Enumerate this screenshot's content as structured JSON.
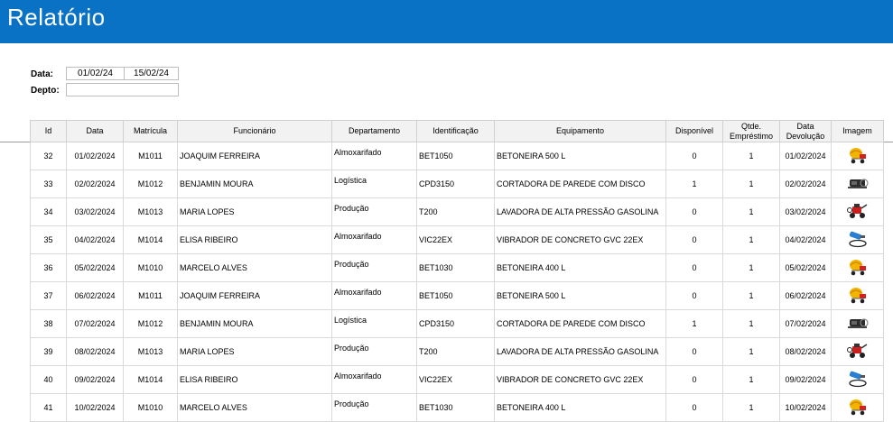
{
  "title": "Relatório",
  "filters": {
    "date_label": "Data:",
    "date_from": "01/02/24",
    "date_to": "15/02/24",
    "depto_label": "Depto:",
    "depto_value": ""
  },
  "table": {
    "headers": {
      "id": "Id",
      "data": "Data",
      "matricula": "Matrícula",
      "funcionario": "Funcionário",
      "departamento": "Departamento",
      "identificacao": "Identificação",
      "equipamento": "Equipamento",
      "disponivel": "Disponível",
      "qtde_line1": "Qtde.",
      "qtde_line2": "Empréstimo",
      "devol_line1": "Data",
      "devol_line2": "Devolução",
      "imagem": "Imagem"
    },
    "rows": [
      {
        "id": "32",
        "data": "01/02/2024",
        "matricula": "M1011",
        "funcionario": "JOAQUIM FERREIRA",
        "departamento": "Almoxarifado",
        "identificacao": "BET1050",
        "equipamento": "BETONEIRA 500 L",
        "disponivel": "0",
        "qtde": "1",
        "devolucao": "01/02/2024",
        "icon": "concrete-mixer-icon"
      },
      {
        "id": "33",
        "data": "02/02/2024",
        "matricula": "M1012",
        "funcionario": "BENJAMIN MOURA",
        "departamento": "Logística",
        "identificacao": "CPD3150",
        "equipamento": "CORTADORA DE PAREDE COM DISCO",
        "disponivel": "1",
        "qtde": "1",
        "devolucao": "02/02/2024",
        "icon": "wall-cutter-icon"
      },
      {
        "id": "34",
        "data": "03/02/2024",
        "matricula": "M1013",
        "funcionario": "MARIA LOPES",
        "departamento": "Produção",
        "identificacao": "T200",
        "equipamento": "LAVADORA DE ALTA PRESSÃO GASOLINA",
        "disponivel": "0",
        "qtde": "1",
        "devolucao": "03/02/2024",
        "icon": "pressure-washer-icon"
      },
      {
        "id": "35",
        "data": "04/02/2024",
        "matricula": "M1014",
        "funcionario": "ELISA RIBEIRO",
        "departamento": "Almoxarifado",
        "identificacao": "VIC22EX",
        "equipamento": "VIBRADOR DE CONCRETO GVC 22EX",
        "disponivel": "0",
        "qtde": "1",
        "devolucao": "04/02/2024",
        "icon": "concrete-vibrator-icon"
      },
      {
        "id": "36",
        "data": "05/02/2024",
        "matricula": "M1010",
        "funcionario": "MARCELO ALVES",
        "departamento": "Produção",
        "identificacao": "BET1030",
        "equipamento": "BETONEIRA 400 L",
        "disponivel": "0",
        "qtde": "1",
        "devolucao": "05/02/2024",
        "icon": "concrete-mixer-icon"
      },
      {
        "id": "37",
        "data": "06/02/2024",
        "matricula": "M1011",
        "funcionario": "JOAQUIM FERREIRA",
        "departamento": "Almoxarifado",
        "identificacao": "BET1050",
        "equipamento": "BETONEIRA 500 L",
        "disponivel": "0",
        "qtde": "1",
        "devolucao": "06/02/2024",
        "icon": "concrete-mixer-icon"
      },
      {
        "id": "38",
        "data": "07/02/2024",
        "matricula": "M1012",
        "funcionario": "BENJAMIN MOURA",
        "departamento": "Logística",
        "identificacao": "CPD3150",
        "equipamento": "CORTADORA DE PAREDE COM DISCO",
        "disponivel": "1",
        "qtde": "1",
        "devolucao": "07/02/2024",
        "icon": "wall-cutter-icon"
      },
      {
        "id": "39",
        "data": "08/02/2024",
        "matricula": "M1013",
        "funcionario": "MARIA LOPES",
        "departamento": "Produção",
        "identificacao": "T200",
        "equipamento": "LAVADORA DE ALTA PRESSÃO GASOLINA",
        "disponivel": "0",
        "qtde": "1",
        "devolucao": "08/02/2024",
        "icon": "pressure-washer-icon"
      },
      {
        "id": "40",
        "data": "09/02/2024",
        "matricula": "M1014",
        "funcionario": "ELISA RIBEIRO",
        "departamento": "Almoxarifado",
        "identificacao": "VIC22EX",
        "equipamento": "VIBRADOR DE CONCRETO GVC 22EX",
        "disponivel": "0",
        "qtde": "1",
        "devolucao": "09/02/2024",
        "icon": "concrete-vibrator-icon"
      },
      {
        "id": "41",
        "data": "10/02/2024",
        "matricula": "M1010",
        "funcionario": "MARCELO ALVES",
        "departamento": "Produção",
        "identificacao": "BET1030",
        "equipamento": "BETONEIRA 400 L",
        "disponivel": "0",
        "qtde": "1",
        "devolucao": "10/02/2024",
        "icon": "concrete-mixer-icon"
      }
    ]
  },
  "colors": {
    "header_bg": "#0a72c4",
    "table_header_bg": "#f2f2f2"
  }
}
